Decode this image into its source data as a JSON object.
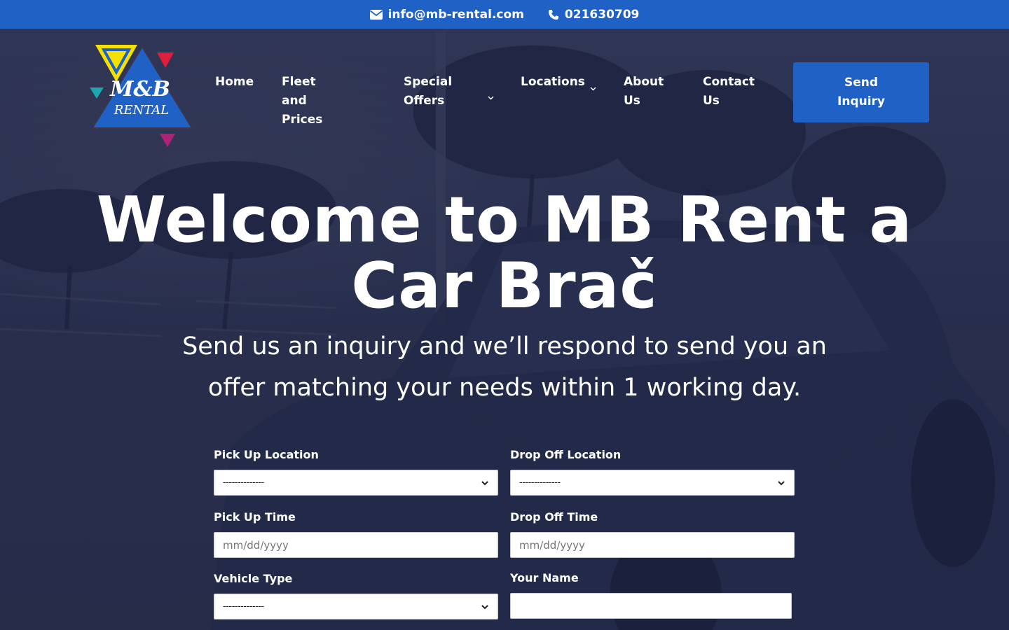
{
  "topbar": {
    "email": "info@mb-rental.com",
    "phone": "021630709"
  },
  "logo": {
    "text_line1": "M&B",
    "text_line2": "RENTAL",
    "colors": {
      "blue": "#1f61c4",
      "yellow": "#f5e100",
      "red": "#e0203a",
      "teal": "#1aa7b0",
      "magenta": "#b0227a"
    }
  },
  "nav": {
    "home": "Home",
    "fleet_line1": "Fleet and",
    "fleet_line2": "Prices",
    "offers_line1": "Special",
    "offers_line2": "Offers",
    "locations": "Locations",
    "about_line1": "About",
    "about_line2": "Us",
    "contact_line1": "Contact",
    "contact_line2": "Us",
    "send_line1": "Send",
    "send_line2": "Inquiry",
    "dropdown_icon": "chevron-down-icon"
  },
  "hero": {
    "title_line1": "Welcome to MB Rent a",
    "title_line2": "Car Brač",
    "subtitle_line1": "Send us an inquiry and we’ll respond to send you an",
    "subtitle_line2": "offer matching your needs within 1 working day."
  },
  "form": {
    "pickup_location": {
      "label": "Pick Up Location",
      "value": "--------------"
    },
    "dropoff_location": {
      "label": "Drop Off Location",
      "value": "--------------"
    },
    "pickup_time": {
      "label": "Pick Up Time",
      "placeholder": "mm/dd/yyyy"
    },
    "dropoff_time": {
      "label": "Drop Off Time",
      "placeholder": "mm/dd/yyyy"
    },
    "vehicle_type": {
      "label": "Vehicle Type",
      "value": "--------------"
    },
    "your_name": {
      "label": "Your Name",
      "value": ""
    }
  },
  "colors": {
    "accent": "#1f61c4",
    "overlay": "#1c2248"
  }
}
